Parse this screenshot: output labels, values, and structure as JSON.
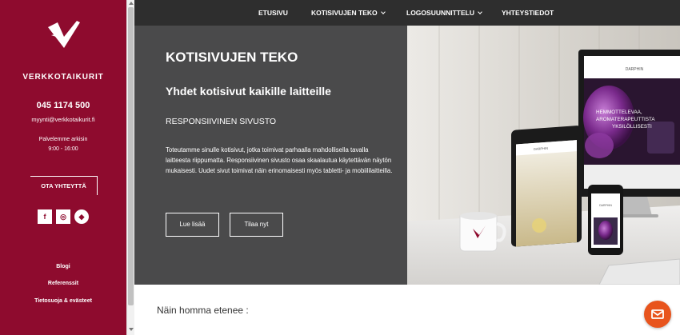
{
  "sidebar": {
    "brand": "VERKKOTAIKURIT",
    "phone": "045 1174 500",
    "email": "myynti@verkkotaikurit.fi",
    "hours_label": "Palvelemme arkisin",
    "hours_time": "9:00 - 16:00",
    "contact_button": "OTA YHTEYTTÄ",
    "socials": [
      {
        "icon": "facebook-icon",
        "glyph": "f"
      },
      {
        "icon": "instagram-icon",
        "glyph": "◎"
      },
      {
        "icon": "partner-diamond-icon",
        "glyph": "◆"
      }
    ],
    "links": [
      "Blogi",
      "Referenssit",
      "Tietosuoja & evästeet"
    ],
    "bg_color": "#8e0b2e"
  },
  "nav": {
    "items": [
      {
        "label": "ETUSIVU",
        "dropdown": false
      },
      {
        "label": "KOTISIVUJEN TEKO",
        "dropdown": true
      },
      {
        "label": "LOGOSUUNNITTELU",
        "dropdown": true
      },
      {
        "label": "YHTEYSTIEDOT",
        "dropdown": false
      }
    ],
    "bg_color": "#2e2e2e"
  },
  "hero": {
    "title": "KOTISIVUJEN TEKO",
    "subtitle": "Yhdet kotisivut kaikille laitteille",
    "tagline": "RESPONSIIVINEN SIVUSTO",
    "description": "Toteutamme sinulle kotisivut, jotka toimivat parhaalla mahdollisella tavalla laitteesta riippumatta. Responsiivinen sivusto osaa skaalautua käytettävän näytön mukaisesti. Uudet sivut toimivat näin erinomaisesti myös tabletti- ja mobiililaitteilla.",
    "buttons": [
      "Lue lisää",
      "Tilaa nyt"
    ],
    "bg_color": "#4a4a4b",
    "image": {
      "monitor_brand": "DARPHIN",
      "monitor_text": "HEMMOTTELEVAA, AROMATERAPEUTTISTA YKSILÖLLISESTI",
      "tablet_brand": "DARPHIN",
      "phone_brand": "DARPHIN"
    }
  },
  "section": {
    "progress_title": "Näin homma etenee :"
  },
  "chat": {
    "icon": "mail-chat-icon",
    "color": "#e8541d"
  }
}
